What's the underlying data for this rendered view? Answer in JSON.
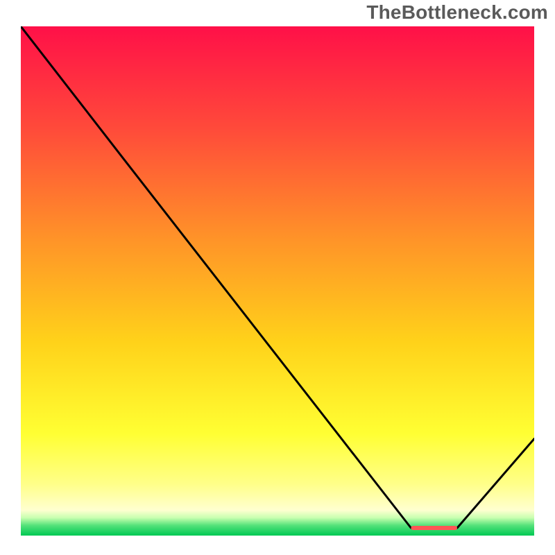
{
  "watermark": "TheBottleneck.com",
  "colors": {
    "gradient_stops": [
      {
        "offset": 0.0,
        "color": "#ff1048"
      },
      {
        "offset": 0.2,
        "color": "#ff4a3a"
      },
      {
        "offset": 0.42,
        "color": "#ff9428"
      },
      {
        "offset": 0.62,
        "color": "#ffd21a"
      },
      {
        "offset": 0.8,
        "color": "#ffff33"
      },
      {
        "offset": 0.9,
        "color": "#ffff8a"
      },
      {
        "offset": 0.95,
        "color": "#ffffd0"
      },
      {
        "offset": 0.965,
        "color": "#c8ffb0"
      },
      {
        "offset": 0.98,
        "color": "#54e27a"
      },
      {
        "offset": 1.0,
        "color": "#00c853"
      }
    ],
    "curve": "#000000",
    "marker": "#ff5555"
  },
  "chart_data": {
    "type": "line",
    "title": "",
    "xlabel": "",
    "ylabel": "",
    "xlim": [
      0,
      100
    ],
    "ylim": [
      0,
      100
    ],
    "legend_position": "none",
    "grid": false,
    "series": [
      {
        "name": "curve",
        "x": [
          0,
          20,
          76,
          82,
          85,
          100
        ],
        "values": [
          100,
          74,
          1.5,
          1.5,
          1.5,
          19
        ]
      }
    ],
    "marker": {
      "x_start": 76,
      "x_end": 85,
      "y": 1.5
    }
  }
}
